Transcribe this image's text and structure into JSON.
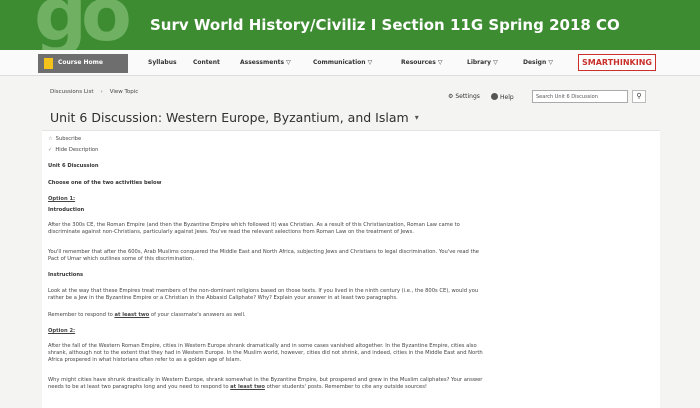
{
  "banner": {
    "logo": "go",
    "title": "Surv World History/Civiliz I Section 11G Spring 2018 CO"
  },
  "nav": {
    "course_home": "Course Home",
    "syllabus": "Syllabus",
    "content": "Content",
    "assessments": "Assessments ▽",
    "communication": "Communication ▽",
    "resources": "Resources ▽",
    "library": "Library ▽",
    "design": "Design ▽",
    "smarthinking": "SMARTHINKING"
  },
  "breadcrumb": {
    "list": "Discussions List",
    "sep": "›",
    "current": "View Topic"
  },
  "tools": {
    "settings": "Settings",
    "help": "Help",
    "search_placeholder": "Search Unit 6 Discussion"
  },
  "page": {
    "title": "Unit 6 Discussion: Western Europe, Byzantium, and Islam",
    "caret": "▾"
  },
  "content": {
    "subscribe": "Subscribe",
    "hide_description": "Hide Description",
    "heading": "Unit 6 Discussion",
    "choose": "Choose one of the two activities below",
    "option1": "Option 1:",
    "intro_heading": "Introduction",
    "intro_p1_a": "After the 300s CE, the Roman Empire (and then the Byzantine Empire which followed it) was Christian. As a result of this Christianization, Roman Law came to",
    "intro_p1_b": "discriminate against non-Christians, particularly against Jews. You've read the relevant selections from Roman Law on the treatment of Jews.",
    "intro_p2_a": "You'll remember that after the 600s, Arab Muslims conquered the Middle East and North Africa, subjecting Jews and Christians to legal discrimination. You've read the",
    "intro_p2_b": "Pact of Umar which outlines some of this discrimination.",
    "instructions_heading": "Instructions",
    "instr_a": "Look at the way that these Empires treat members of the non-dominant religions based on those texts. If you lived in the ninth century (i.e., the 800s CE), would you",
    "instr_b": "rather be a Jew in the Byzantine Empire or a Christian in the Abbasid Caliphate? Why? Explain your answer in at least two paragraphs.",
    "remember_pre": "Remember to respond to ",
    "remember_bold": "at least two",
    "remember_post": " of your classmate's answers as well.",
    "option2": "Option 2:",
    "opt2_a": "After the fall of the Western Roman Empire, cities in Western Europe shrank dramatically and in some cases vanished altogether. In the Byzantine Empire, cities also",
    "opt2_b": "shrank, although not to the extent that they had in Western Europe. In the Muslim world, however, cities did not shrink, and indeed, cities in the Middle East and North",
    "opt2_c": "Africa prospered in what historians often refer to as a golden age of Islam.",
    "why_a": "Why might cities have shrunk drastically in Western Europe, shrank somewhat in the Byzantine Empire, but prospered and grew in the Muslim caliphates? Your answer",
    "why_b_pre": "needs to be at least two paragraphs long and you need to respond to ",
    "why_b_bold": "at least two",
    "why_b_post": " other students' posts. Remember to cite any outside sources!"
  }
}
